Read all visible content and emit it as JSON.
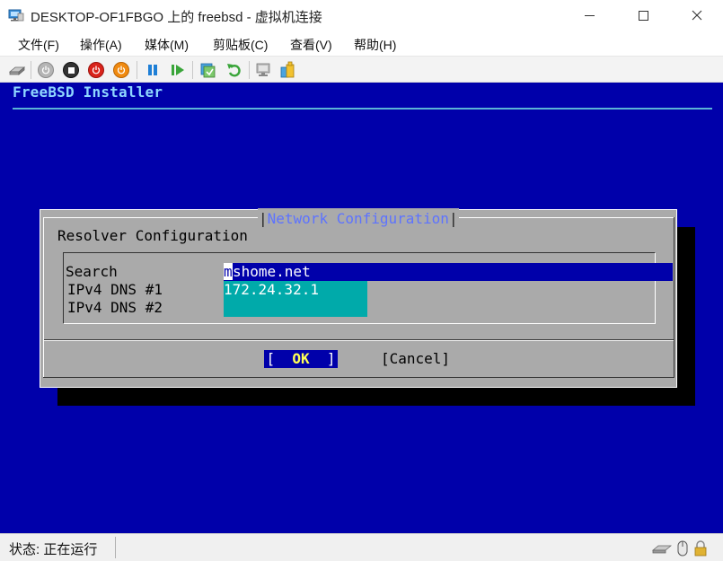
{
  "window": {
    "title": "DESKTOP-OF1FBGO 上的 freebsd - 虚拟机连接"
  },
  "menu": [
    {
      "label": "文件(F)"
    },
    {
      "label": "操作(A)"
    },
    {
      "label": "媒体(M)"
    },
    {
      "label": "剪贴板(C)"
    },
    {
      "label": "查看(V)"
    },
    {
      "label": "帮助(H)"
    }
  ],
  "toolbar": {
    "icons": [
      "ctrl-alt-del-icon",
      "start-icon",
      "turn-off-icon",
      "shut-down-icon",
      "power-icon",
      "pause-icon",
      "resume-icon",
      "checkpoint-icon",
      "revert-icon",
      "enhanced-session-icon",
      "share-icon"
    ]
  },
  "console": {
    "installer_title": "FreeBSD Installer",
    "dialog": {
      "title": "Network Configuration",
      "heading": "Resolver Configuration",
      "fields": {
        "search_label": "Search",
        "search_value_first": "m",
        "search_value_rest": "shome.net",
        "dns1_label": "IPv4 DNS #1",
        "dns1_value": "172.24.32.1",
        "dns2_label": "IPv4 DNS #2",
        "dns2_value": ""
      },
      "ok_left": "[",
      "ok_label": "OK",
      "ok_right": "]",
      "cancel_label": "[Cancel]"
    }
  },
  "status": {
    "text": "状态: 正在运行"
  },
  "colors": {
    "console_bg": "#0000aa",
    "dialog_bg": "#aaaaaa",
    "field_active": "#0000aa",
    "field_inactive": "#00aaaa",
    "title_accent": "#8fd7ff"
  }
}
